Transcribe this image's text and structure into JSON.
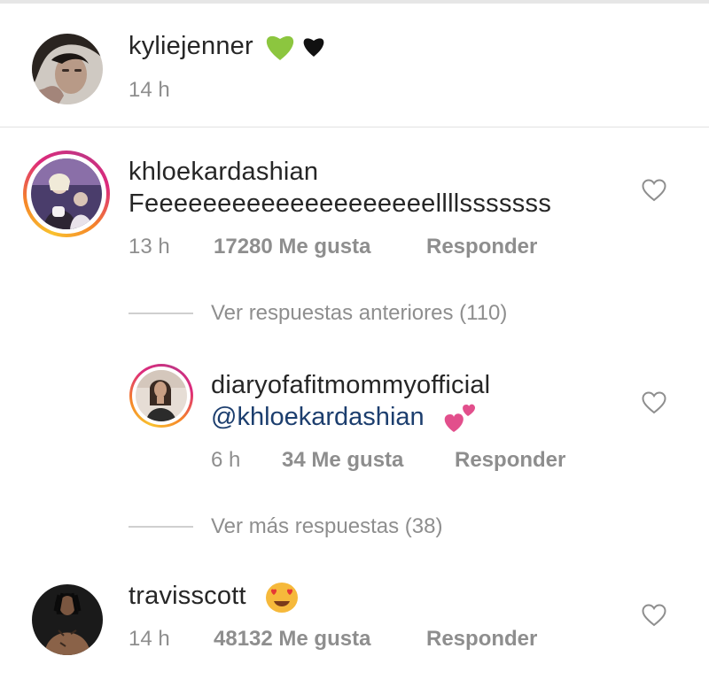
{
  "caption": {
    "username": "kyliejenner",
    "emoji": "💚🖤",
    "time": "14 h"
  },
  "comments": [
    {
      "username": "khloekardashian",
      "text": "Feeeeeeeeeeeeeeeeeeeellllsssssss",
      "time": "13 h",
      "likes": "17280 Me gusta",
      "reply": "Responder"
    },
    {
      "username": "travisscott",
      "emoji": "😍",
      "time": "14 h",
      "likes": "48132 Me gusta",
      "reply": "Responder"
    }
  ],
  "thread": {
    "view_previous": "Ver respuestas anteriores (110)",
    "view_more": "Ver más respuestas (38)"
  },
  "reply": {
    "username": "diaryofafitmommyofficial",
    "mention": "@khloekardashian",
    "emoji": "💕",
    "time": "6 h",
    "likes": "34 Me gusta",
    "reply": "Responder"
  },
  "colors": {
    "text": "#262626",
    "meta": "#8e8e8e",
    "mention": "#1c3e6e",
    "story_ring": "#dd2a7b"
  }
}
